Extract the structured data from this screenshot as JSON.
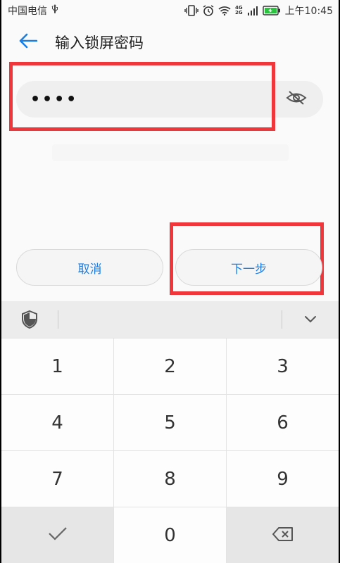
{
  "status_bar": {
    "carrier": "中国电信",
    "usb_icon": "usb-icon",
    "icons": [
      "vibrate-icon",
      "alarm-icon",
      "wifi-icon",
      "signal-icon",
      "battery-icon"
    ],
    "network_label_top": "4G",
    "network_label_bottom": "2G",
    "time": "上午10:45"
  },
  "header": {
    "back_icon": "back-arrow-icon",
    "title": "输入锁屏密码"
  },
  "password_field": {
    "value": "••••",
    "toggle_icon": "eye-off-icon"
  },
  "buttons": {
    "cancel": "取消",
    "next": "下一步"
  },
  "keyboard_toolbar": {
    "left_icon": "shield-icon",
    "right_icon": "chevron-down-icon"
  },
  "keypad": {
    "keys": [
      "1",
      "2",
      "3",
      "4",
      "5",
      "6",
      "7",
      "8",
      "9",
      "0"
    ],
    "confirm_icon": "checkmark-icon",
    "delete_icon": "backspace-icon"
  },
  "colors": {
    "accent": "#1a7ee6",
    "highlight_box": "#f0353b"
  }
}
